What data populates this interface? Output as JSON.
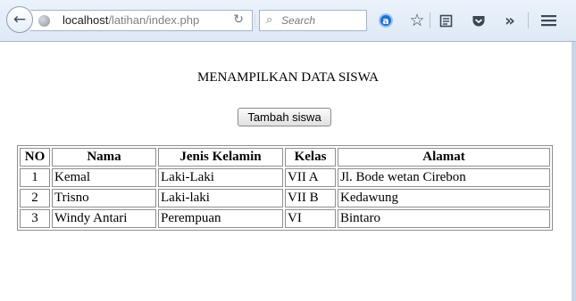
{
  "browser": {
    "url_host": "localhost",
    "url_path": "/latihan/index.php",
    "search_placeholder": "Search",
    "icons": [
      "back-icon",
      "globe-icon",
      "reload-icon",
      "search-icon",
      "addon-icon",
      "star-icon",
      "reading-list-icon",
      "pocket-icon",
      "overflow-icon",
      "menu-icon"
    ]
  },
  "page": {
    "title": "MENAMPILKAN DATA SISWA",
    "add_button": "Tambah siswa"
  },
  "table": {
    "headers": [
      "NO",
      "Nama",
      "Jenis Kelamin",
      "Kelas",
      "Alamat"
    ],
    "rows": [
      [
        "1",
        "Kemal",
        "Laki-Laki",
        "VII A",
        "Jl. Bode wetan Cirebon"
      ],
      [
        "2",
        "Trisno",
        "Laki-laki",
        "VII B",
        "Kedawung"
      ],
      [
        "3",
        "Windy Antari",
        "Perempuan",
        "VI",
        "Bintaro"
      ]
    ]
  }
}
